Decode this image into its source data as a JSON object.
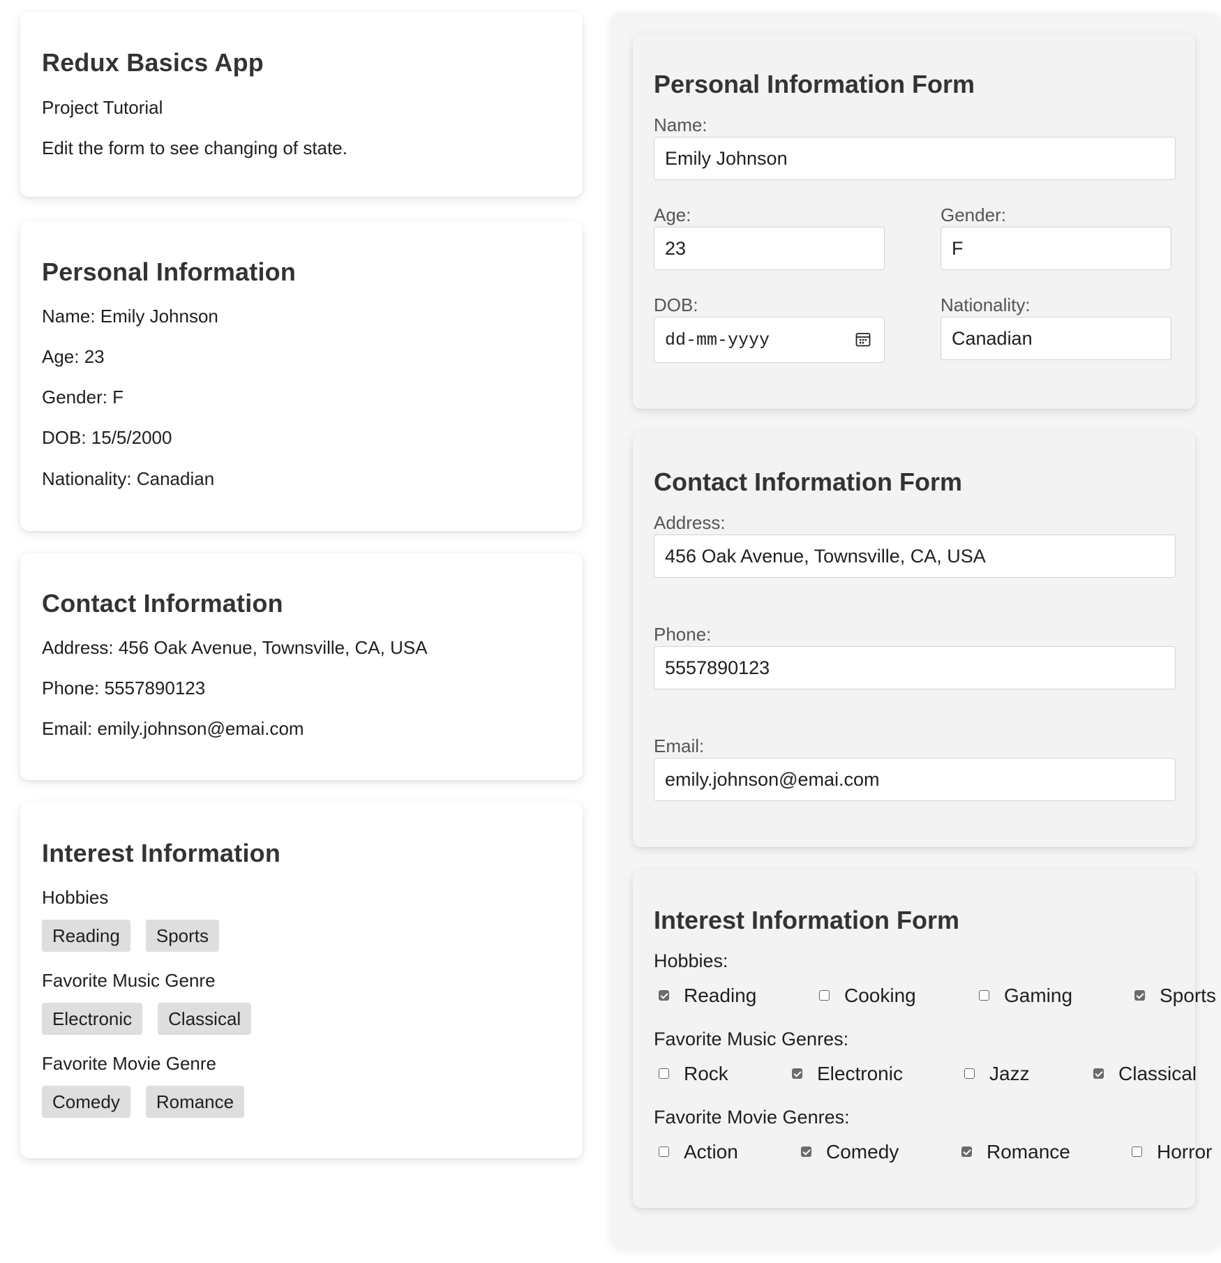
{
  "app": {
    "title": "Redux Basics App",
    "subtitle": "Project Tutorial",
    "description": "Edit the form to see changing of state."
  },
  "personal_display": {
    "heading": "Personal Information",
    "name": "Name: Emily Johnson",
    "age": "Age: 23",
    "gender": "Gender: F",
    "dob": "DOB: 15/5/2000",
    "nationality": "Nationality: Canadian"
  },
  "contact_display": {
    "heading": "Contact Information",
    "address": "Address: 456 Oak Avenue, Townsville, CA, USA",
    "phone": "Phone: 5557890123",
    "email": "Email: emily.johnson@emai.com"
  },
  "interest_display": {
    "heading": "Interest Information",
    "hobbies_label": "Hobbies",
    "hobbies": [
      "Reading",
      "Sports"
    ],
    "music_label": "Favorite Music Genre",
    "music": [
      "Electronic",
      "Classical"
    ],
    "movie_label": "Favorite Movie Genre",
    "movies": [
      "Comedy",
      "Romance"
    ]
  },
  "personal_form": {
    "heading": "Personal Information Form",
    "name_label": "Name:",
    "name_value": "Emily Johnson",
    "age_label": "Age:",
    "age_value": "23",
    "gender_label": "Gender:",
    "gender_value": "F",
    "dob_label": "DOB:",
    "dob_placeholder": "dd-mm-yyyy",
    "dob_icon": "calendar-icon",
    "nationality_label": "Nationality:",
    "nationality_value": "Canadian"
  },
  "contact_form": {
    "heading": "Contact Information Form",
    "address_label": "Address:",
    "address_value": "456 Oak Avenue, Townsville, CA, USA",
    "phone_label": "Phone:",
    "phone_value": "5557890123",
    "email_label": "Email:",
    "email_value": "emily.johnson@emai.com"
  },
  "interest_form": {
    "heading": "Interest Information Form",
    "hobbies_label": "Hobbies:",
    "hobbies": [
      {
        "label": "Reading",
        "checked": true
      },
      {
        "label": "Cooking",
        "checked": false
      },
      {
        "label": "Gaming",
        "checked": false
      },
      {
        "label": "Sports",
        "checked": true
      }
    ],
    "music_label": "Favorite Music Genres:",
    "music": [
      {
        "label": "Rock",
        "checked": false
      },
      {
        "label": "Electronic",
        "checked": true
      },
      {
        "label": "Jazz",
        "checked": false
      },
      {
        "label": "Classical",
        "checked": true
      }
    ],
    "movie_label": "Favorite Movie Genres:",
    "movies": [
      {
        "label": "Action",
        "checked": false
      },
      {
        "label": "Comedy",
        "checked": true
      },
      {
        "label": "Romance",
        "checked": true
      },
      {
        "label": "Horror",
        "checked": false
      }
    ]
  },
  "colors": {
    "chip_bg": "#dedede",
    "checkbox_checked": "#6b6b6b",
    "heading": "#333333",
    "form_panel_bg": "#f3f3f3"
  }
}
